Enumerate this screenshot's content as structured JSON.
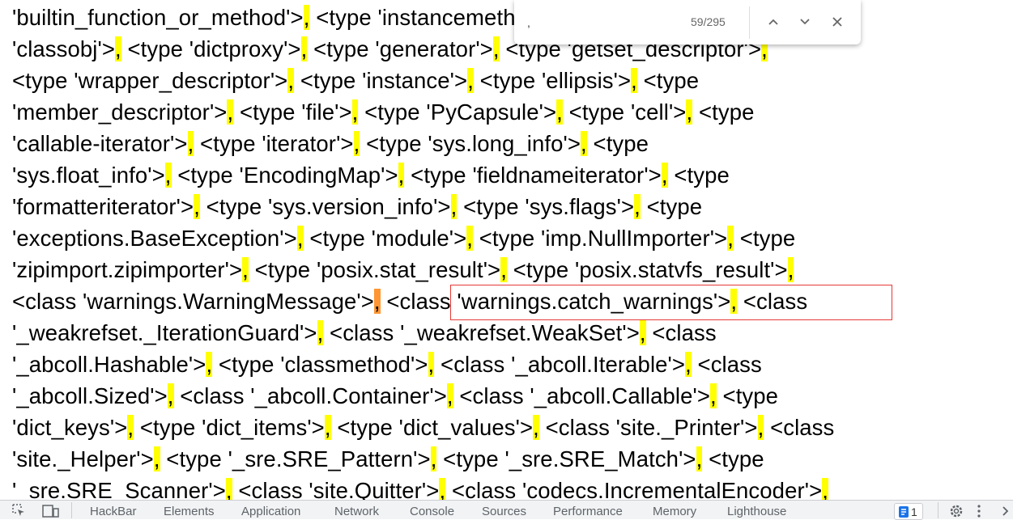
{
  "content": {
    "lines": [
      "'builtin_function_or_method'>, <type 'instancemethod'>, <type 'function'>, <type",
      "'classobj'>, <type 'dictproxy'>, <type 'generator'>, <type 'getset_descriptor'>,",
      "<type 'wrapper_descriptor'>, <type 'instance'>, <type 'ellipsis'>, <type",
      "'member_descriptor'>, <type 'file'>, <type 'PyCapsule'>, <type 'cell'>, <type",
      "'callable-iterator'>, <type 'iterator'>, <type 'sys.long_info'>, <type",
      "'sys.float_info'>, <type 'EncodingMap'>, <type 'fieldnameiterator'>, <type",
      "'formatteriterator'>, <type 'sys.version_info'>, <type 'sys.flags'>, <type",
      "'exceptions.BaseException'>, <type 'module'>, <type 'imp.NullImporter'>, <type",
      "'zipimport.zipimporter'>, <type 'posix.stat_result'>, <type 'posix.statvfs_result'>,",
      "<class 'warnings.WarningMessage'>, <class 'warnings.catch_warnings'>, <class",
      "'_weakrefset._IterationGuard'>, <class '_weakrefset.WeakSet'>, <class",
      "'_abcoll.Hashable'>, <type 'classmethod'>, <class '_abcoll.Iterable'>, <class",
      "'_abcoll.Sized'>, <class '_abcoll.Container'>, <class '_abcoll.Callable'>, <type",
      "'dict_keys'>, <type 'dict_items'>, <type 'dict_values'>, <class 'site._Printer'>, <class",
      "'site._Helper'>, <type '_sre.SRE_Pattern'>, <type '_sre.SRE_Match'>, <type",
      "'_sre.SRE_Scanner'>, <class 'site.Quitter'>, <class 'codecs.IncrementalEncoder'>,"
    ],
    "active_match": {
      "line": 9,
      "comma_index": 0
    },
    "highlight_color": "#ffff00",
    "active_highlight_color": "#ff9632",
    "annotation_box_color": "#e53935"
  },
  "find_bar": {
    "query": ",",
    "count": "59/295",
    "prev_icon": "chevron-up-icon",
    "next_icon": "chevron-down-icon",
    "close_icon": "close-icon"
  },
  "devtools": {
    "tabs": [
      "HackBar",
      "Elements",
      "Application",
      "Network",
      "Console",
      "Sources",
      "Performance",
      "Memory",
      "Lighthouse"
    ],
    "issues_count": "1"
  }
}
